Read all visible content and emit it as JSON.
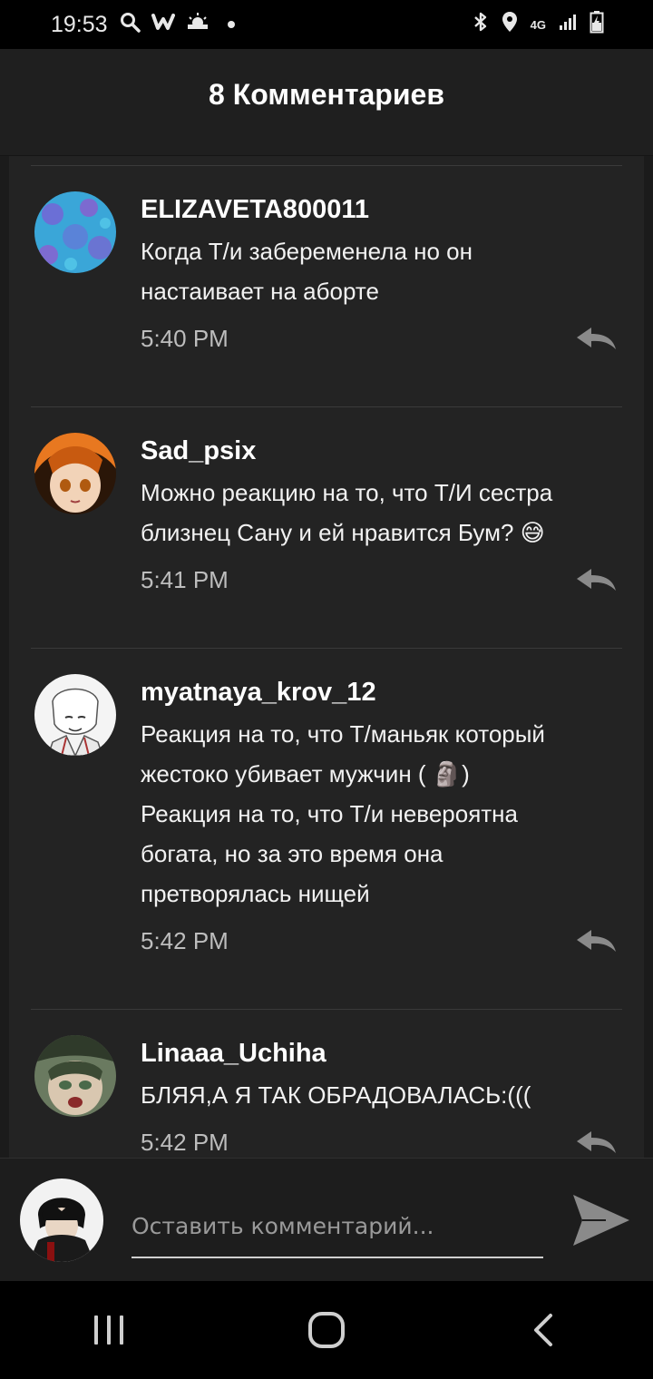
{
  "status_bar": {
    "time": "19:53",
    "network": "4G"
  },
  "header": {
    "title": "8 Комментариев"
  },
  "comments": [
    {
      "username": "ELIZAVETA800011",
      "text": "Когда Т/и забеременела но он\nнастаивает на аборте",
      "time": "5:40 PM",
      "avatar_icon": "blue-pattern-avatar"
    },
    {
      "username": "Sad_psix",
      "text": "Можно реакцию на то, что Т/И сестра\nблизнец Сану и ей нравится Бум? 😅",
      "time": "5:41 PM",
      "avatar_icon": "anime-girl-avatar"
    },
    {
      "username": "myatnaya_krov_12",
      "text": "Реакция на то, что Т/маньяк который\nжестоко убивает мужчин ( 🗿)\nРеакция на то, что Т/и невероятна\nбогата, но за это время она\nпретворялась нищей",
      "time": "5:42 PM",
      "avatar_icon": "sketch-character-avatar"
    },
    {
      "username": "Linaaa_Uchiha",
      "text": "БЛЯЯ,А Я ТАК ОБРАДОВАЛАСЬ:(((",
      "time": "5:42 PM",
      "avatar_icon": "anime-character-avatar"
    }
  ],
  "input": {
    "placeholder": "Оставить комментарий..."
  },
  "colors": {
    "background": "#1b1b1b",
    "card": "#232323",
    "accent_icon": "#8a8a8a"
  }
}
